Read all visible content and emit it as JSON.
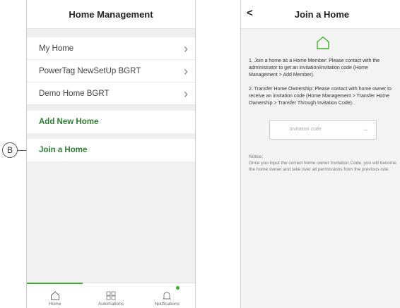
{
  "left": {
    "title": "Home Management",
    "homes": [
      {
        "label": "My Home"
      },
      {
        "label": "PowerTag NewSetUp BGRT"
      },
      {
        "label": "Demo Home BGRT"
      }
    ],
    "add_new_home": "Add New Home",
    "join_home": "Join a Home",
    "callout": "B",
    "tabs": [
      {
        "label": "Home"
      },
      {
        "label": "Automations"
      },
      {
        "label": "Notifications"
      }
    ]
  },
  "right": {
    "title": "Join a Home",
    "back": "<",
    "para1": "1. Join a home as a Home Member: Please contact with the administrator to get an invitation/invitation code (Home Management > Add Member).",
    "para2": "2. Transfer Home Ownership: Please contact with home owner to receive an invitation code (Home Management > Transfer Home Ownership > Transfer Through Invitation Code).",
    "invite_placeholder": "Invitation code",
    "notice_title": "Notice:",
    "notice_text": "Once you input the correct home owner Invitation Code, you will become the home owner and take over all permissions from the previous role."
  },
  "colors": {
    "accent": "#3dae2b",
    "green_text": "#2e7d32"
  }
}
